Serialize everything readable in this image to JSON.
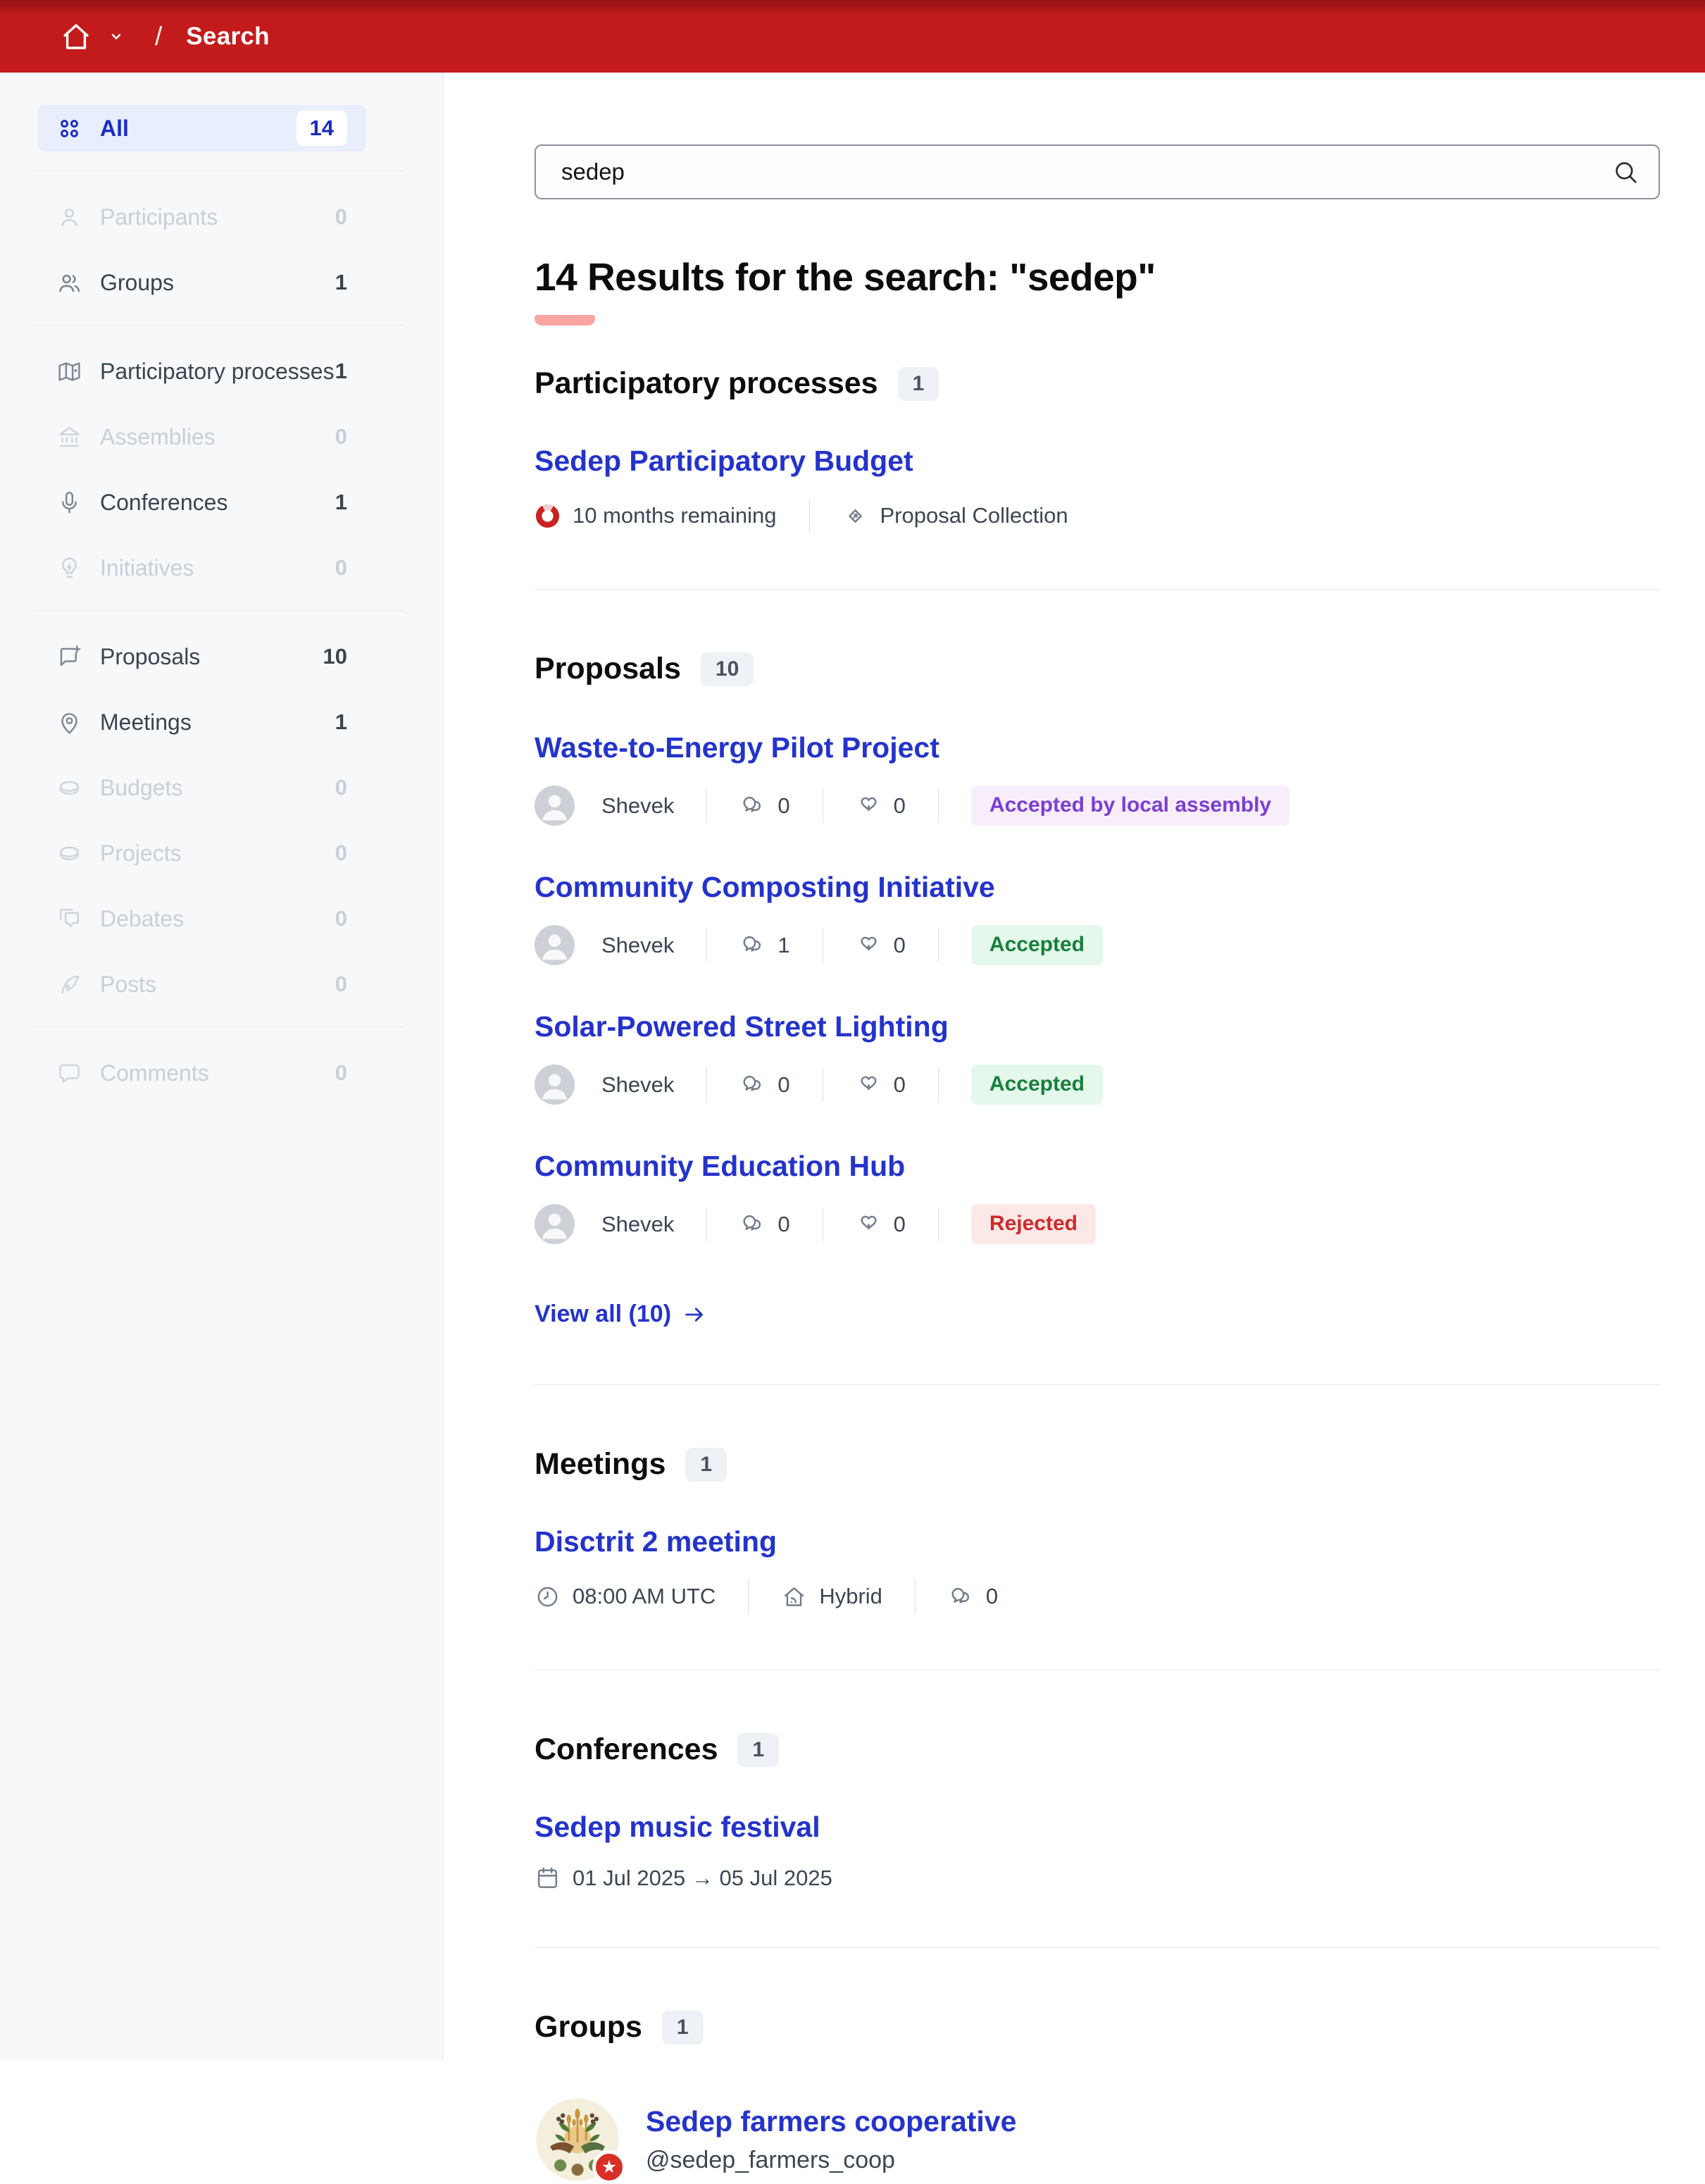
{
  "colors": {
    "header_red": "#c31b1b",
    "link_blue": "#2433cb",
    "sidebar_selected_bg": "#e8eefb",
    "sidebar_selected_text": "#1b2cc1",
    "heading_underline_pink": "#f9a5a2",
    "status_accepted_text": "#17803c",
    "status_accepted_bg": "#e4f8ec",
    "status_rejected_text": "#cf2a2a",
    "status_rejected_bg": "#fce9e7",
    "status_assembly_text": "#7d3dd2",
    "status_assembly_bg": "#f8eefb",
    "timer_red": "#c92222",
    "group_badge_red": "#d82f27"
  },
  "header": {
    "breadcrumb_separator": "/",
    "breadcrumb_current": "Search"
  },
  "sidebar": {
    "items": [
      {
        "label": "All",
        "count": "14"
      },
      {
        "label": "Participants",
        "count": "0"
      },
      {
        "label": "Groups",
        "count": "1"
      },
      {
        "label": "Participatory processes",
        "count": "1"
      },
      {
        "label": "Assemblies",
        "count": "0"
      },
      {
        "label": "Conferences",
        "count": "1"
      },
      {
        "label": "Initiatives",
        "count": "0"
      },
      {
        "label": "Proposals",
        "count": "10"
      },
      {
        "label": "Meetings",
        "count": "1"
      },
      {
        "label": "Budgets",
        "count": "0"
      },
      {
        "label": "Projects",
        "count": "0"
      },
      {
        "label": "Debates",
        "count": "0"
      },
      {
        "label": "Posts",
        "count": "0"
      },
      {
        "label": "Comments",
        "count": "0"
      }
    ]
  },
  "search": {
    "value": "sedep"
  },
  "results": {
    "heading": "14 Results for the search: \"sedep\""
  },
  "sections": {
    "processes": {
      "title": "Participatory processes",
      "count": "1",
      "item": {
        "title": "Sedep Participatory Budget",
        "remaining": "10 months remaining",
        "phase": "Proposal Collection"
      }
    },
    "proposals": {
      "title": "Proposals",
      "count": "10",
      "view_all": "View all (10)",
      "items": [
        {
          "title": "Waste-to-Energy Pilot Project",
          "author": "Shevek",
          "comments": "0",
          "endorsements": "0",
          "status": "Accepted by local assembly"
        },
        {
          "title": "Community Composting Initiative",
          "author": "Shevek",
          "comments": "1",
          "endorsements": "0",
          "status": "Accepted"
        },
        {
          "title": "Solar-Powered Street Lighting",
          "author": "Shevek",
          "comments": "0",
          "endorsements": "0",
          "status": "Accepted"
        },
        {
          "title": "Community Education Hub",
          "author": "Shevek",
          "comments": "0",
          "endorsements": "0",
          "status": "Rejected"
        }
      ]
    },
    "meetings": {
      "title": "Meetings",
      "count": "1",
      "item": {
        "title": "Disctrit 2 meeting",
        "time": "08:00 AM UTC",
        "mode": "Hybrid",
        "comments": "0"
      }
    },
    "conferences": {
      "title": "Conferences",
      "count": "1",
      "item": {
        "title": "Sedep music festival",
        "dates": "01 Jul 2025 → 05 Jul 2025"
      }
    },
    "groups": {
      "title": "Groups",
      "count": "1",
      "item": {
        "name": "Sedep farmers cooperative",
        "handle": "@sedep_farmers_coop",
        "badge": "★"
      }
    }
  }
}
